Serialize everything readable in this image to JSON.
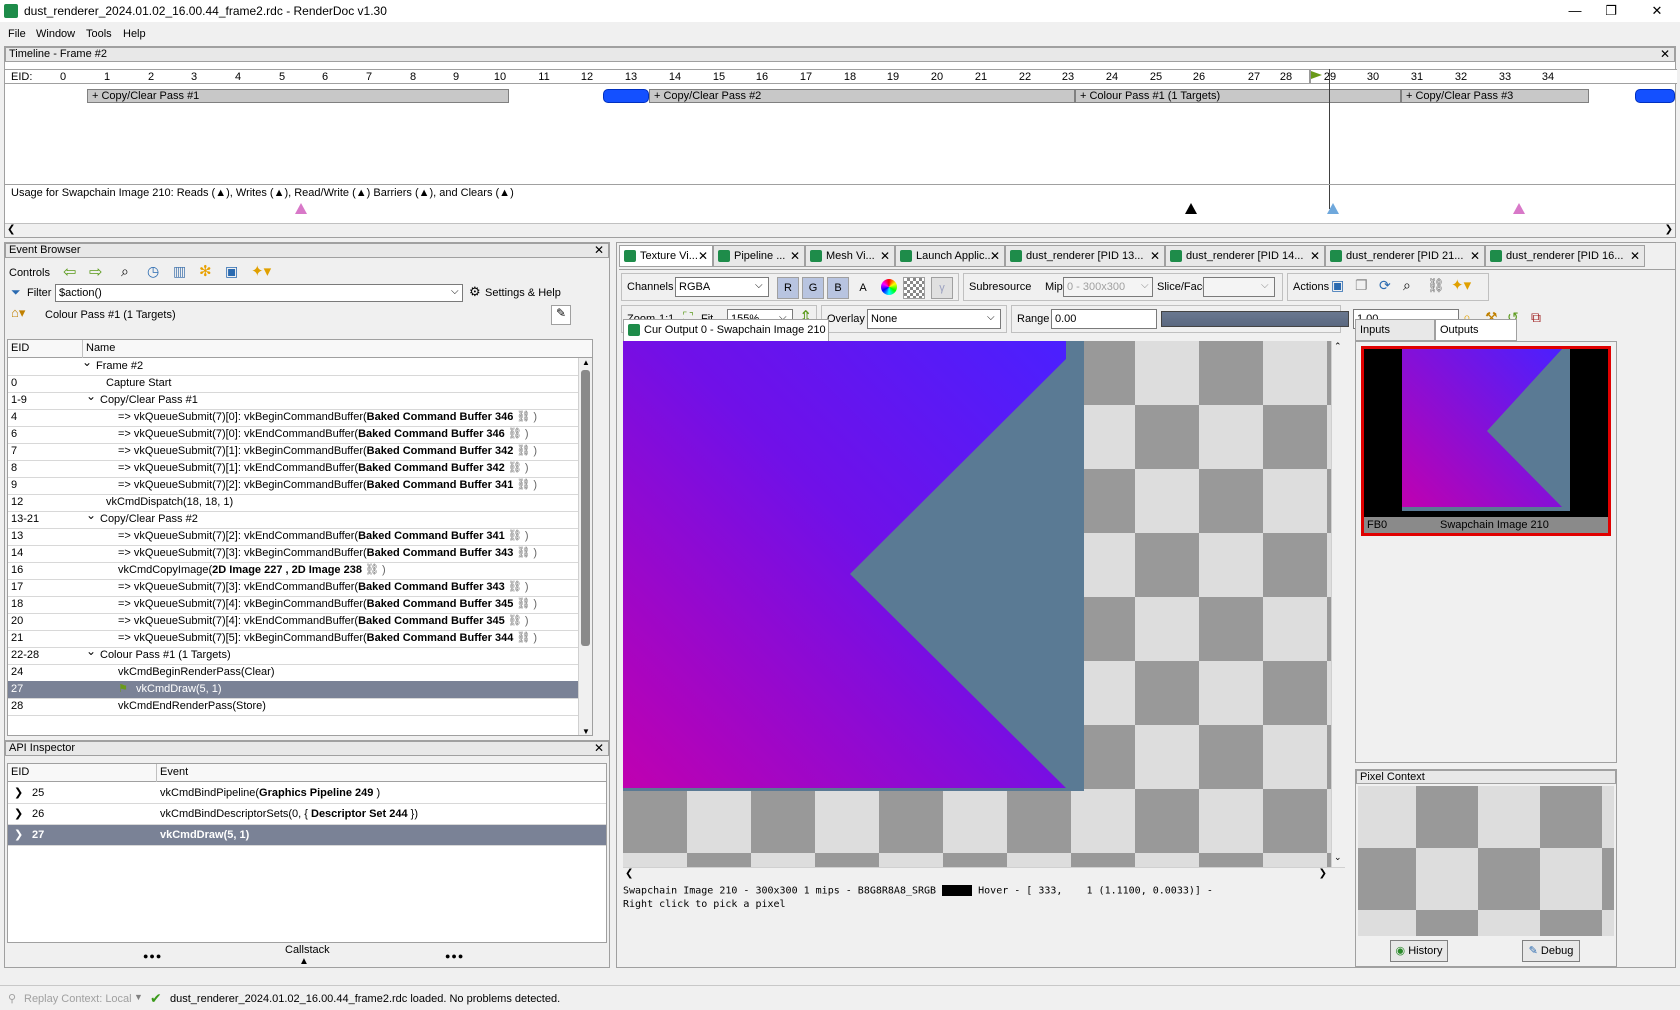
{
  "window": {
    "title": "dust_renderer_2024.01.02_16.00.44_frame2.rdc - RenderDoc v1.30",
    "minimize": "—",
    "maximize": "❐",
    "close": "✕"
  },
  "menu": [
    "File",
    "Window",
    "Tools",
    "Help"
  ],
  "timeline": {
    "title": "Timeline - Frame #2",
    "eid_label": "EID:",
    "ticks": [
      "0",
      "1",
      "2",
      "3",
      "4",
      "5",
      "6",
      "7",
      "8",
      "9",
      "10",
      "11",
      "12",
      "13",
      "14",
      "15",
      "16",
      "17",
      "18",
      "19",
      "20",
      "21",
      "22",
      "23",
      "24",
      "25",
      "26",
      "27",
      "28",
      "29",
      "30",
      "31",
      "32",
      "33",
      "34"
    ],
    "passes": [
      "+ Copy/Clear Pass #1",
      "+ Copy/Clear Pass #2",
      "+ Colour Pass #1 (1 Targets)",
      "+ Copy/Clear Pass #3"
    ],
    "usage": "Usage for Swapchain Image 210: Reads (▲), Writes (▲), Read/Write (▲) Barriers (▲), and Clears (▲)",
    "usage_color_reads": "#e8c000",
    "usage_color_writes": "#6fa8dc",
    "usage_color_barriers": "#d878c8",
    "flag_color": "#6a9a1a"
  },
  "event_browser": {
    "title": "Event Browser",
    "controls_label": "Controls",
    "filter_label": "Filter",
    "filter_value": "$action()",
    "settings_label": "Settings & Help",
    "breadcrumb": "Colour Pass #1 (1 Targets)",
    "col_eid": "EID",
    "col_name": "Name",
    "rows": [
      {
        "eid": "",
        "name": "Frame #2",
        "plain": "",
        "chev": "v"
      },
      {
        "eid": "0",
        "name": "Capture Start",
        "plain": "",
        "chev": ""
      },
      {
        "eid": "1-9",
        "name": "Copy/Clear Pass #1",
        "plain": "",
        "chev": "v"
      },
      {
        "eid": "4",
        "name": "=> vkQueueSubmit(7)[0]: vkBeginCommandBuffer(",
        "bold": "Baked Command Buffer 346",
        "chev": ""
      },
      {
        "eid": "6",
        "name": "=> vkQueueSubmit(7)[0]: vkEndCommandBuffer(",
        "bold": "Baked Command Buffer 346",
        "chev": ""
      },
      {
        "eid": "7",
        "name": "=> vkQueueSubmit(7)[1]: vkBeginCommandBuffer(",
        "bold": "Baked Command Buffer 342",
        "chev": ""
      },
      {
        "eid": "8",
        "name": "=> vkQueueSubmit(7)[1]: vkEndCommandBuffer(",
        "bold": "Baked Command Buffer 342",
        "chev": ""
      },
      {
        "eid": "9",
        "name": "=> vkQueueSubmit(7)[2]: vkBeginCommandBuffer(",
        "bold": "Baked Command Buffer 341",
        "chev": ""
      },
      {
        "eid": "12",
        "name": "vkCmdDispatch(18, 18, 1)",
        "plain": "",
        "chev": ""
      },
      {
        "eid": "13-21",
        "name": "Copy/Clear Pass #2",
        "plain": "",
        "chev": "v"
      },
      {
        "eid": "13",
        "name": "=> vkQueueSubmit(7)[2]: vkEndCommandBuffer(",
        "bold": "Baked Command Buffer 341",
        "chev": ""
      },
      {
        "eid": "14",
        "name": "=> vkQueueSubmit(7)[3]: vkBeginCommandBuffer(",
        "bold": "Baked Command Buffer 343",
        "chev": ""
      },
      {
        "eid": "16",
        "name": "vkCmdCopyImage(",
        "bold": "2D Image 227 , 2D Image 238",
        "chev": ""
      },
      {
        "eid": "17",
        "name": "=> vkQueueSubmit(7)[3]: vkEndCommandBuffer(",
        "bold": "Baked Command Buffer 343",
        "chev": ""
      },
      {
        "eid": "18",
        "name": "=> vkQueueSubmit(7)[4]: vkBeginCommandBuffer(",
        "bold": "Baked Command Buffer 345",
        "chev": ""
      },
      {
        "eid": "20",
        "name": "=> vkQueueSubmit(7)[4]: vkEndCommandBuffer(",
        "bold": "Baked Command Buffer 345",
        "chev": ""
      },
      {
        "eid": "21",
        "name": "=> vkQueueSubmit(7)[5]: vkBeginCommandBuffer(",
        "bold": "Baked Command Buffer 344",
        "chev": ""
      },
      {
        "eid": "22-28",
        "name": "Colour Pass #1 (1 Targets)",
        "plain": "",
        "chev": "v"
      },
      {
        "eid": "24",
        "name": "vkCmdBeginRenderPass(Clear)",
        "plain": "",
        "chev": ""
      },
      {
        "eid": "27",
        "name": "vkCmdDraw(5, 1)",
        "plain": "",
        "chev": "",
        "selected": true
      },
      {
        "eid": "28",
        "name": "vkCmdEndRenderPass(Store)",
        "plain": "",
        "chev": ""
      }
    ]
  },
  "api_inspector": {
    "title": "API Inspector",
    "col_eid": "EID",
    "col_event": "Event",
    "rows": [
      {
        "eid": "25",
        "pre": "vkCmdBindPipeline(",
        "bold": "Graphics Pipeline 249",
        "post": " )"
      },
      {
        "eid": "26",
        "pre": "vkCmdBindDescriptorSets(0, { ",
        "bold": "Descriptor Set 244",
        "post": " })"
      },
      {
        "eid": "27",
        "pre": "",
        "bold": "vkCmdDraw(5, 1)",
        "post": "",
        "selected": true
      }
    ],
    "callstack": "Callstack",
    "dots": "●●●"
  },
  "tabs": [
    "Texture Vi...",
    "Pipeline ...",
    "Mesh Vi...",
    "Launch Applic...",
    "dust_renderer [PID 13...",
    "dust_renderer [PID 14...",
    "dust_renderer [PID 21...",
    "dust_renderer [PID 16..."
  ],
  "texture_viewer": {
    "channels_label": "Channels",
    "channels_value": "RGBA",
    "r": "R",
    "g": "G",
    "b": "B",
    "a": "A",
    "subresource": "Subresource",
    "mip_label": "Mip",
    "mip_value": "0 - 300x300",
    "slice_label": "Slice/Face",
    "actions_label": "Actions",
    "zoom_label": "Zoom",
    "zoom_11": "1:1",
    "fit_label": "Fit",
    "zoom_value": "155%",
    "overlay_label": "Overlay",
    "overlay_value": "None",
    "range_label": "Range",
    "range_min": "0.00",
    "range_max": "1.00",
    "output_tab": "Cur Output 0 - Swapchain Image 210",
    "status_line1": "Swapchain Image 210 - 300x300 1 mips - B8G8R8A8_SRGB",
    "status_hover": "Hover - [ 333,    1 (1.1100, 0.0033)] -",
    "status_line2": "Right click to pick a pixel",
    "inputs_tab": "Inputs",
    "outputs_tab": "Outputs",
    "thumb_fb": "FB0",
    "thumb_label": "Swapchain Image 210",
    "pixel_context": "Pixel Context",
    "history": "History",
    "debug": "Debug"
  },
  "status_bar": {
    "replay": "Replay Context: Local",
    "message": "dust_renderer_2024.01.02_16.00.44_frame2.rdc loaded. No problems detected."
  }
}
